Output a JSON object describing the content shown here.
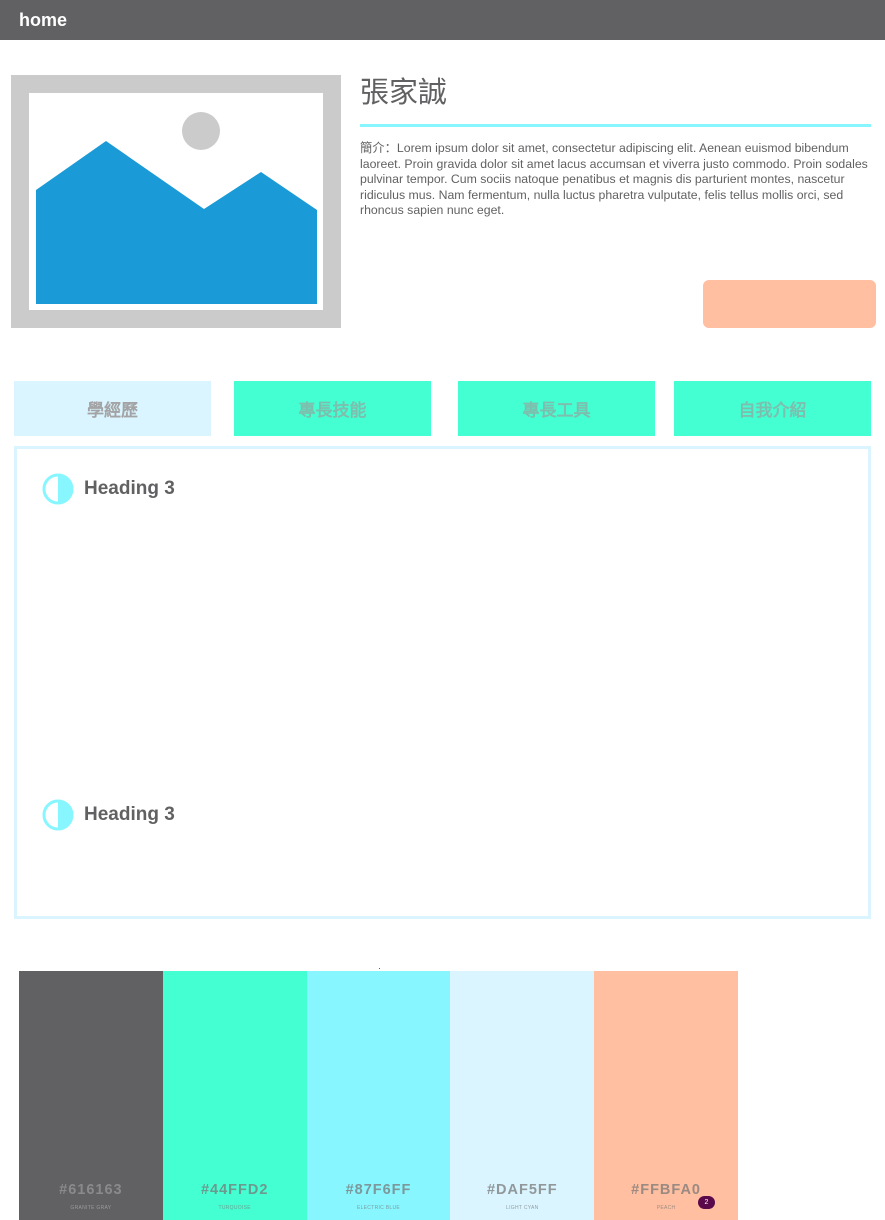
{
  "header": {
    "title": "home"
  },
  "profile": {
    "name": "張家誠",
    "bio": "簡介：Lorem ipsum dolor sit amet, consectetur adipiscing elit. Aenean euismod bibendum laoreet. Proin gravida dolor sit amet lacus accumsan et viverra justo commodo. Proin sodales pulvinar tempor. Cum sociis natoque penatibus et magnis dis parturient montes, nascetur ridiculus mus. Nam fermentum, nulla luctus pharetra vulputate, felis tellus mollis orci, sed rhoncus sapien nunc eget.",
    "image_icon": "image-placeholder-icon",
    "button_label": "",
    "button_color": "#FFBFA0"
  },
  "tabs": [
    {
      "label": "學經歷",
      "active": true
    },
    {
      "label": "專長技能",
      "active": false
    },
    {
      "label": "專長工具",
      "active": false
    },
    {
      "label": "自我介紹",
      "active": false
    }
  ],
  "panel": {
    "sections": [
      {
        "heading": "Heading 3",
        "icon": "half-circle-icon"
      },
      {
        "heading": "Heading 3",
        "icon": "half-circle-icon"
      }
    ]
  },
  "palette": {
    "swatches": [
      {
        "hex": "#616163",
        "name": "GRANITE GRAY"
      },
      {
        "hex": "#44FFD2",
        "name": "TURQUOISE"
      },
      {
        "hex": "#87F6FF",
        "name": "ELECTRIC BLUE"
      },
      {
        "hex": "#DAF5FF",
        "name": "LIGHT CYAN"
      },
      {
        "hex": "#FFBFA0",
        "name": "PEACH"
      }
    ],
    "badge_count": "2"
  },
  "colors": {
    "granite_gray": "#616163",
    "turquoise": "#44FFD2",
    "electric_blue": "#87F6FF",
    "light_cyan": "#DAF5FF",
    "peach": "#FFBFA0",
    "image_blue": "#1A9AD6",
    "image_gray": "#CBCBCB"
  }
}
